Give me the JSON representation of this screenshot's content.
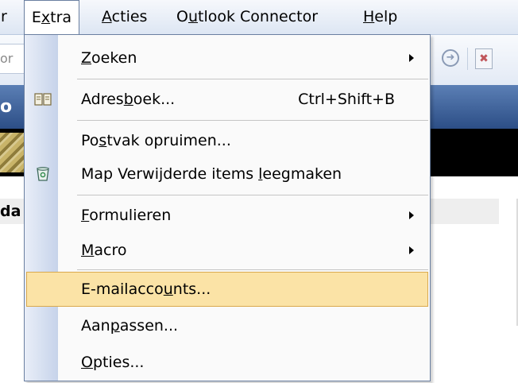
{
  "menubar": {
    "items": [
      {
        "pre": "",
        "u": "r",
        "post": ""
      },
      {
        "pre": "E",
        "u": "x",
        "post": "tra"
      },
      {
        "pre": "",
        "u": "A",
        "post": "cties"
      },
      {
        "pre": "O",
        "u": "u",
        "post": "tlook Connector"
      },
      {
        "pre": "",
        "u": "H",
        "post": "elp"
      }
    ]
  },
  "background": {
    "search_stub": "or",
    "header_label": "o",
    "section_label": "da"
  },
  "icons": {
    "forward": "nav-forward-icon",
    "close_doc": "close-doc-icon",
    "address_book": "address-book-icon",
    "trash": "recycle-bin-icon"
  },
  "colors": {
    "highlight_fill": "#fbe3a6",
    "highlight_border": "#d9a94d",
    "menu_gutter": "#c6d3ea",
    "header_band": "#2c4e86"
  },
  "menu": {
    "items": [
      {
        "pre": "",
        "u": "Z",
        "post": "oeken",
        "shortcut": "",
        "submenu": true
      },
      {
        "pre": "Adres",
        "u": "b",
        "post": "oek...",
        "shortcut": "Ctrl+Shift+B",
        "submenu": false
      },
      {
        "pre": "Po",
        "u": "s",
        "post": "tvak opruimen...",
        "shortcut": "",
        "submenu": false
      },
      {
        "pre": "Map Verwijderde items ",
        "u": "l",
        "post": "eegmaken",
        "shortcut": "",
        "submenu": false
      },
      {
        "pre": "",
        "u": "F",
        "post": "ormulieren",
        "shortcut": "",
        "submenu": true
      },
      {
        "pre": "",
        "u": "M",
        "post": "acro",
        "shortcut": "",
        "submenu": true
      },
      {
        "pre": "E-mailacco",
        "u": "u",
        "post": "nts...",
        "shortcut": "",
        "submenu": false,
        "highlighted": true
      },
      {
        "pre": "Aan",
        "u": "p",
        "post": "assen...",
        "shortcut": "",
        "submenu": false
      },
      {
        "pre": "",
        "u": "O",
        "post": "pties...",
        "shortcut": "",
        "submenu": false
      }
    ]
  }
}
